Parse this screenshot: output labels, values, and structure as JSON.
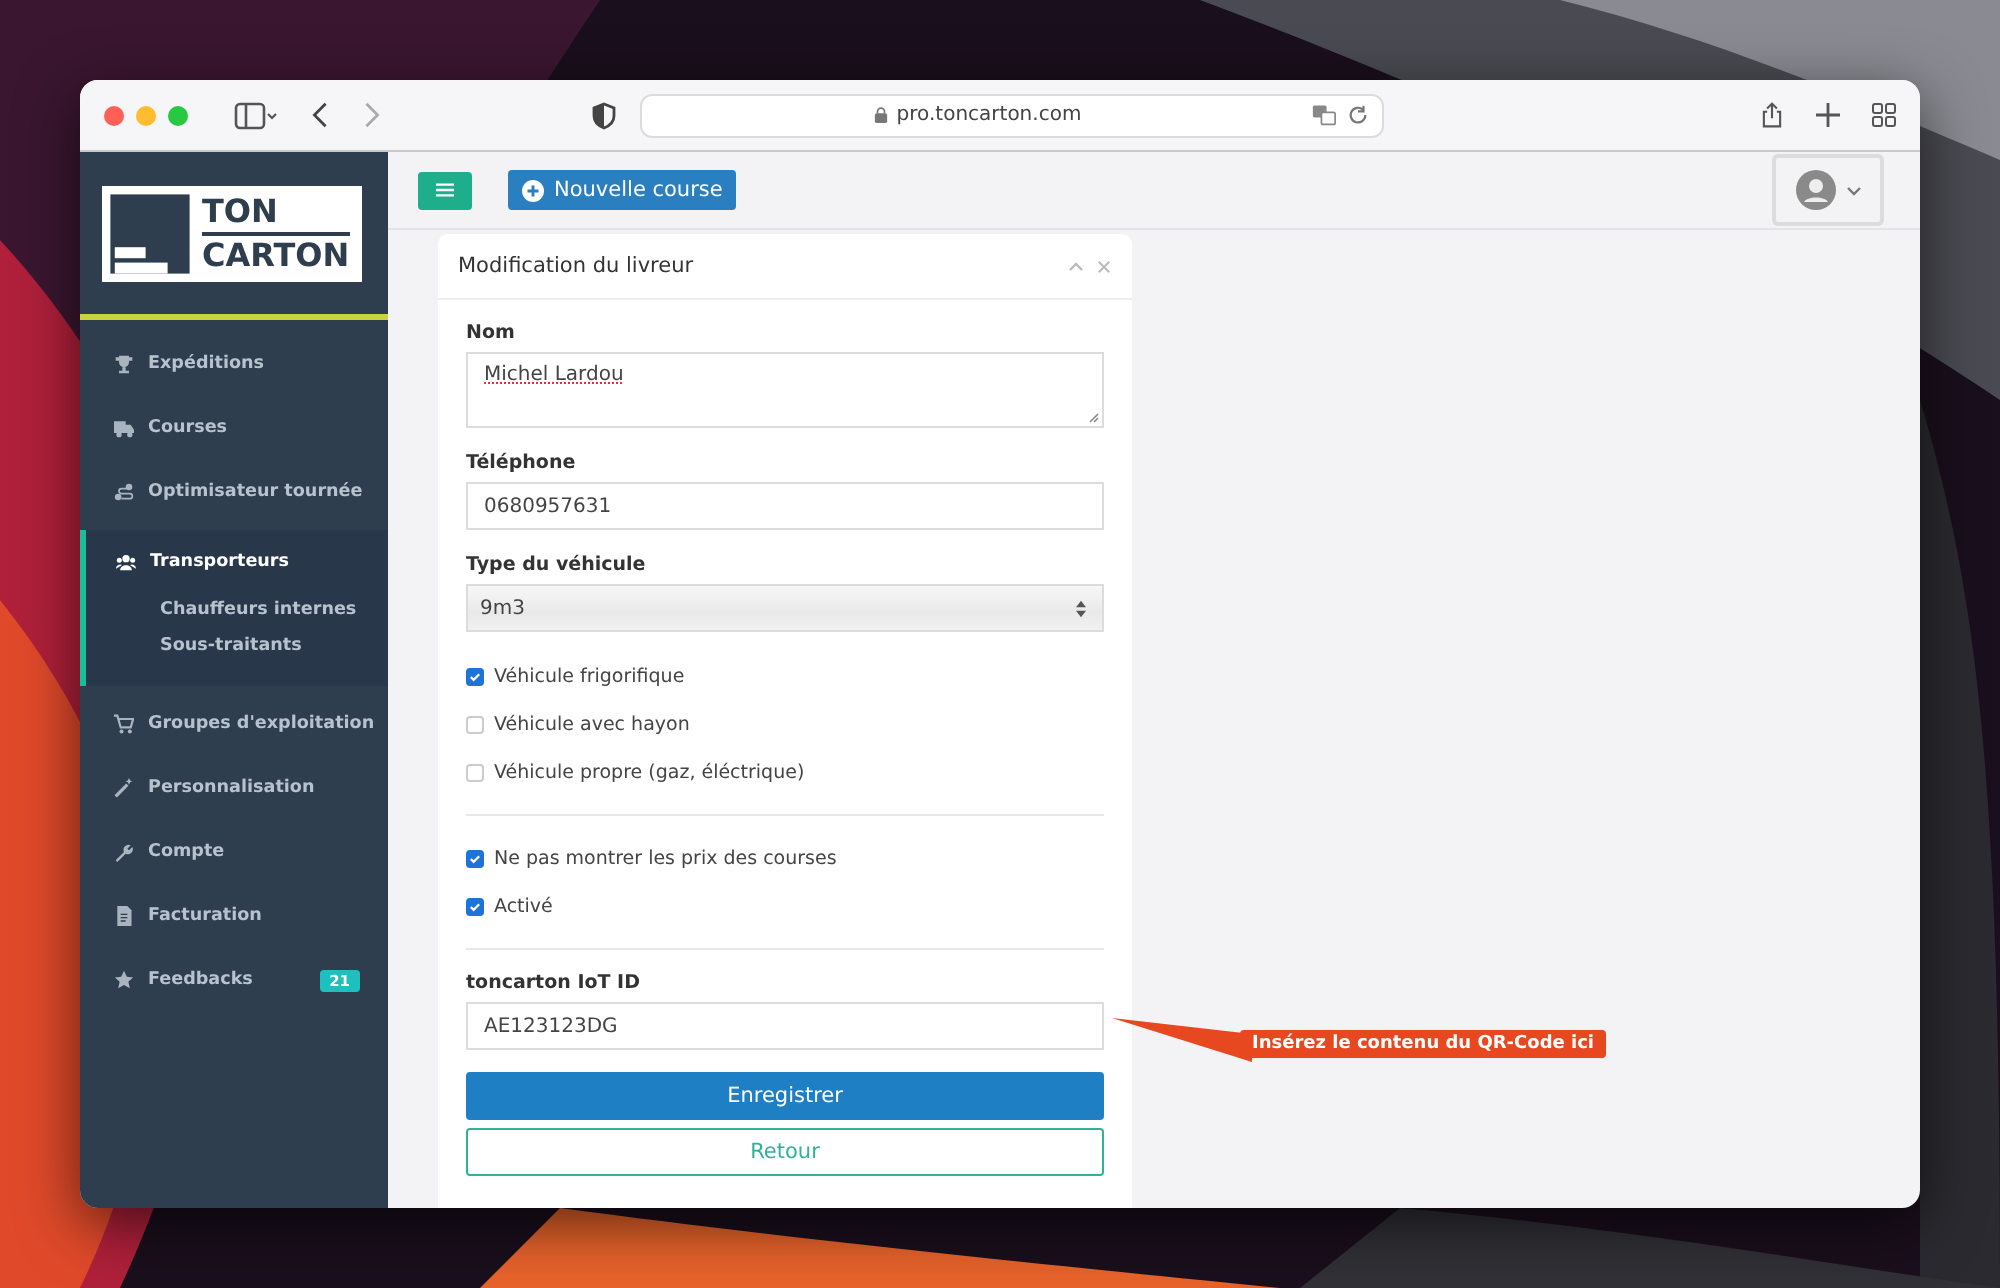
{
  "browser": {
    "url": "pro.toncarton.com"
  },
  "sidebar": {
    "logo": [
      "TON",
      "CARTON"
    ],
    "items": [
      {
        "label": "Expéditions",
        "selected": false
      },
      {
        "label": "Courses",
        "selected": false
      },
      {
        "label": "Optimisateur tournée",
        "selected": false
      },
      {
        "label": "Transporteurs",
        "selected": true,
        "children": [
          {
            "label": "Chauffeurs internes"
          },
          {
            "label": "Sous-traitants"
          }
        ]
      },
      {
        "label": "Groupes d'exploitation",
        "selected": false
      },
      {
        "label": "Personnalisation",
        "selected": false
      },
      {
        "label": "Compte",
        "selected": false
      },
      {
        "label": "Facturation",
        "selected": false
      },
      {
        "label": "Feedbacks",
        "selected": false,
        "badge": "21"
      }
    ]
  },
  "topbar": {
    "new_button": "Nouvelle course"
  },
  "form": {
    "title": "Modification du livreur",
    "groups": [
      [
        {
          "kind": "textarea",
          "label": "Nom",
          "value": "Michel Lardou"
        },
        {
          "kind": "input",
          "label": "Téléphone",
          "value": "0680957631"
        },
        {
          "kind": "select",
          "label": "Type du véhicule",
          "value": "9m3"
        },
        {
          "kind": "checkbox",
          "label": "Véhicule frigorifique",
          "checked": true
        },
        {
          "kind": "checkbox",
          "label": "Véhicule avec hayon",
          "checked": false
        },
        {
          "kind": "checkbox",
          "label": "Véhicule propre (gaz, éléctrique)",
          "checked": false
        }
      ],
      [
        {
          "kind": "checkbox",
          "label": "Ne pas montrer les prix des courses",
          "checked": true
        },
        {
          "kind": "checkbox",
          "label": "Activé",
          "checked": true
        }
      ],
      [
        {
          "kind": "input",
          "label": "toncarton IoT ID",
          "value": "AE123123DG"
        }
      ]
    ],
    "buttons": [
      {
        "label": "Enregistrer",
        "kind": "primary"
      },
      {
        "label": "Retour",
        "kind": "outline"
      }
    ]
  },
  "callout": {
    "text": "Insérez le contenu du QR-Code ici"
  }
}
